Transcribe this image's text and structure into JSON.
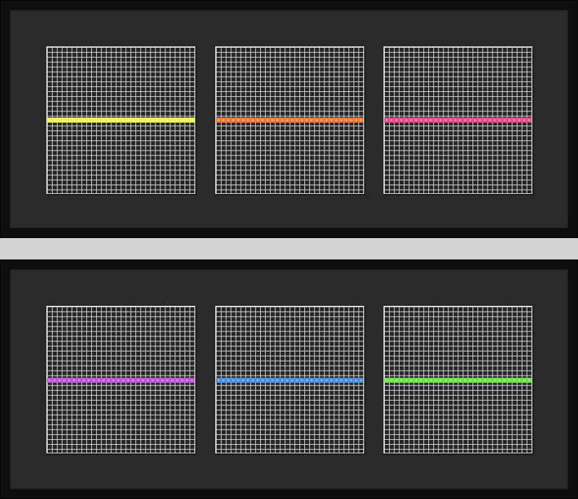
{
  "artwork": {
    "frames": [
      {
        "id": "top",
        "panels": [
          {
            "stripe_color": "#f2f052",
            "stripe_row": 15
          },
          {
            "stripe_color": "#f07838",
            "stripe_row": 15
          },
          {
            "stripe_color": "#f0488e",
            "stripe_row": 15
          }
        ]
      },
      {
        "id": "bottom",
        "panels": [
          {
            "stripe_color": "#c254d8",
            "stripe_row": 15
          },
          {
            "stripe_color": "#4c8ee0",
            "stripe_row": 15
          },
          {
            "stripe_color": "#6ee048",
            "stripe_row": 15
          }
        ]
      }
    ],
    "grid_cells_per_side": 30,
    "colors": {
      "page_background": "#d3d3d3",
      "frame": "#0e0e0e",
      "mat": "#2a2a2a",
      "grid_line": "#d9d9d9"
    }
  }
}
